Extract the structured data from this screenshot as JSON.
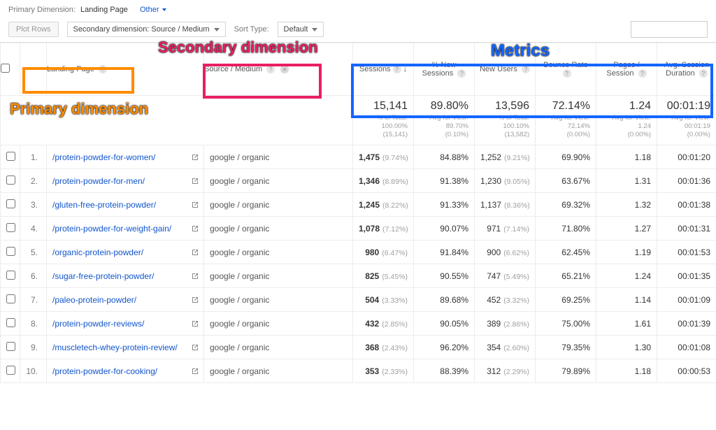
{
  "toolbar": {
    "primary_dim_label": "Primary Dimension:",
    "primary_dim_value": "Landing Page",
    "other_label": "Other",
    "plot_rows": "Plot Rows",
    "secondary_dim": "Secondary dimension: Source / Medium",
    "sort_type_label": "Sort Type:",
    "sort_type_value": "Default"
  },
  "annotations": {
    "primary": "Primary dimension",
    "secondary": "Secondary dimension",
    "metrics": "Metrics"
  },
  "headers": {
    "landing_page": "Landing Page",
    "source_medium": "Source / Medium",
    "metrics": [
      "Sessions",
      "% New Sessions",
      "New Users",
      "Bounce Rate",
      "Pages / Session",
      "Avg. Session Duration"
    ]
  },
  "totals": [
    {
      "big": "15,141",
      "sub1": "% of Total:",
      "sub2": "100.00%",
      "sub3": "(15,141)"
    },
    {
      "big": "89.80%",
      "sub1": "Avg for View:",
      "sub2": "89.70%",
      "sub3": "(0.10%)"
    },
    {
      "big": "13,596",
      "sub1": "% of Total:",
      "sub2": "100.10%",
      "sub3": "(13,582)"
    },
    {
      "big": "72.14%",
      "sub1": "Avg for View:",
      "sub2": "72.14%",
      "sub3": "(0.00%)"
    },
    {
      "big": "1.24",
      "sub1": "Avg for View:",
      "sub2": "1.24",
      "sub3": "(0.00%)"
    },
    {
      "big": "00:01:19",
      "sub1": "Avg for View:",
      "sub2": "00:01:19",
      "sub3": "(0.00%)"
    }
  ],
  "rows": [
    {
      "n": "1.",
      "page": "/protein-powder-for-women/",
      "src": "google / organic",
      "sess": "1,475",
      "sesspct": "(9.74%)",
      "pnew": "84.88%",
      "newu": "1,252",
      "newupct": "(9.21%)",
      "bounce": "69.90%",
      "pps": "1.18",
      "dur": "00:01:20"
    },
    {
      "n": "2.",
      "page": "/protein-powder-for-men/",
      "src": "google / organic",
      "sess": "1,346",
      "sesspct": "(8.89%)",
      "pnew": "91.38%",
      "newu": "1,230",
      "newupct": "(9.05%)",
      "bounce": "63.67%",
      "pps": "1.31",
      "dur": "00:01:36"
    },
    {
      "n": "3.",
      "page": "/gluten-free-protein-powder/",
      "src": "google / organic",
      "sess": "1,245",
      "sesspct": "(8.22%)",
      "pnew": "91.33%",
      "newu": "1,137",
      "newupct": "(8.36%)",
      "bounce": "69.32%",
      "pps": "1.32",
      "dur": "00:01:38"
    },
    {
      "n": "4.",
      "page": "/protein-powder-for-weight-gain/",
      "src": "google / organic",
      "sess": "1,078",
      "sesspct": "(7.12%)",
      "pnew": "90.07%",
      "newu": "971",
      "newupct": "(7.14%)",
      "bounce": "71.80%",
      "pps": "1.27",
      "dur": "00:01:31"
    },
    {
      "n": "5.",
      "page": "/organic-protein-powder/",
      "src": "google / organic",
      "sess": "980",
      "sesspct": "(6.47%)",
      "pnew": "91.84%",
      "newu": "900",
      "newupct": "(6.62%)",
      "bounce": "62.45%",
      "pps": "1.19",
      "dur": "00:01:53"
    },
    {
      "n": "6.",
      "page": "/sugar-free-protein-powder/",
      "src": "google / organic",
      "sess": "825",
      "sesspct": "(5.45%)",
      "pnew": "90.55%",
      "newu": "747",
      "newupct": "(5.49%)",
      "bounce": "65.21%",
      "pps": "1.24",
      "dur": "00:01:35"
    },
    {
      "n": "7.",
      "page": "/paleo-protein-powder/",
      "src": "google / organic",
      "sess": "504",
      "sesspct": "(3.33%)",
      "pnew": "89.68%",
      "newu": "452",
      "newupct": "(3.32%)",
      "bounce": "69.25%",
      "pps": "1.14",
      "dur": "00:01:09"
    },
    {
      "n": "8.",
      "page": "/protein-powder-reviews/",
      "src": "google / organic",
      "sess": "432",
      "sesspct": "(2.85%)",
      "pnew": "90.05%",
      "newu": "389",
      "newupct": "(2.86%)",
      "bounce": "75.00%",
      "pps": "1.61",
      "dur": "00:01:39"
    },
    {
      "n": "9.",
      "page": "/muscletech-whey-protein-review/",
      "src": "google / organic",
      "sess": "368",
      "sesspct": "(2.43%)",
      "pnew": "96.20%",
      "newu": "354",
      "newupct": "(2.60%)",
      "bounce": "79.35%",
      "pps": "1.30",
      "dur": "00:01:08"
    },
    {
      "n": "10.",
      "page": "/protein-powder-for-cooking/",
      "src": "google / organic",
      "sess": "353",
      "sesspct": "(2.33%)",
      "pnew": "88.39%",
      "newu": "312",
      "newupct": "(2.29%)",
      "bounce": "79.89%",
      "pps": "1.18",
      "dur": "00:00:53"
    }
  ]
}
